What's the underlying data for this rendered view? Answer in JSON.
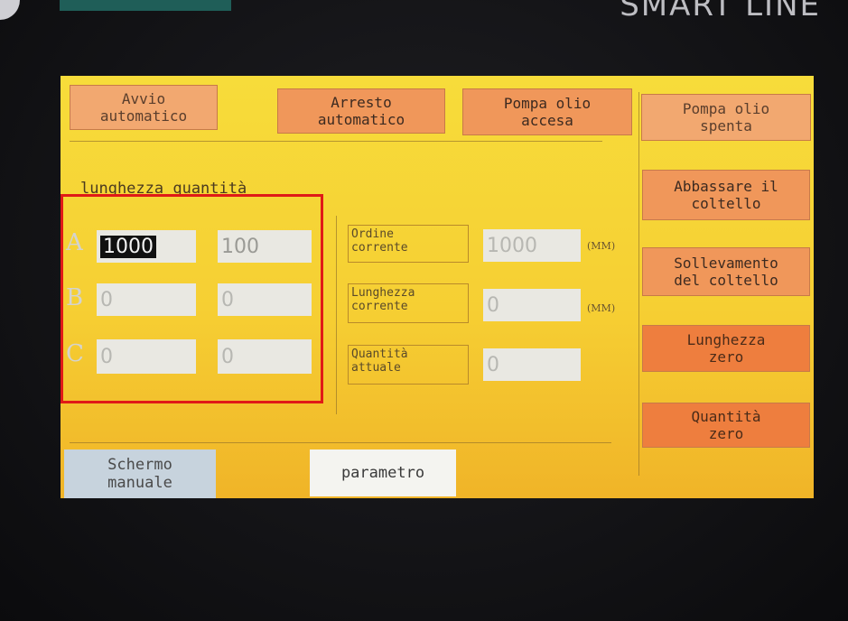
{
  "brand": "SMART LINE",
  "top_buttons": {
    "auto_start": "Avvio\nautomatico",
    "auto_stop": "Arresto\nautomatico",
    "oil_pump_on": "Pompa olio\naccesa",
    "oil_pump_off": "Pompa olio\nspenta"
  },
  "side_buttons": {
    "lower_knife": "Abbassare il\ncoltello",
    "lift_knife": "Sollevamento\ndel coltello",
    "zero_length": "Lunghezza\nzero",
    "zero_quantity": "Quantità\nzero"
  },
  "table": {
    "header": "lunghezza quantità",
    "rows": [
      {
        "label": "A",
        "length_selected": "1000",
        "quantity": "100"
      },
      {
        "label": "B",
        "length": "0",
        "quantity": "0"
      },
      {
        "label": "C",
        "length": "0",
        "quantity": "0"
      }
    ]
  },
  "status": {
    "current_order_label": "Ordine\ncorrente",
    "current_order_value": "1000",
    "current_order_unit": "(MM)",
    "current_length_label": "Lunghezza\ncorrente",
    "current_length_value": "0",
    "current_length_unit": "(MM)",
    "current_quantity_label": "Quantità\nattuale",
    "current_quantity_value": "0"
  },
  "bottom_tabs": {
    "manual_screen": "Schermo\nmanuale",
    "parameter": "parametro"
  },
  "colors": {
    "screen_bg": "#f6cf33",
    "button_orange": "#f0975a",
    "highlight_box": "#e01a17",
    "field_bg": "#e9e8e2"
  }
}
